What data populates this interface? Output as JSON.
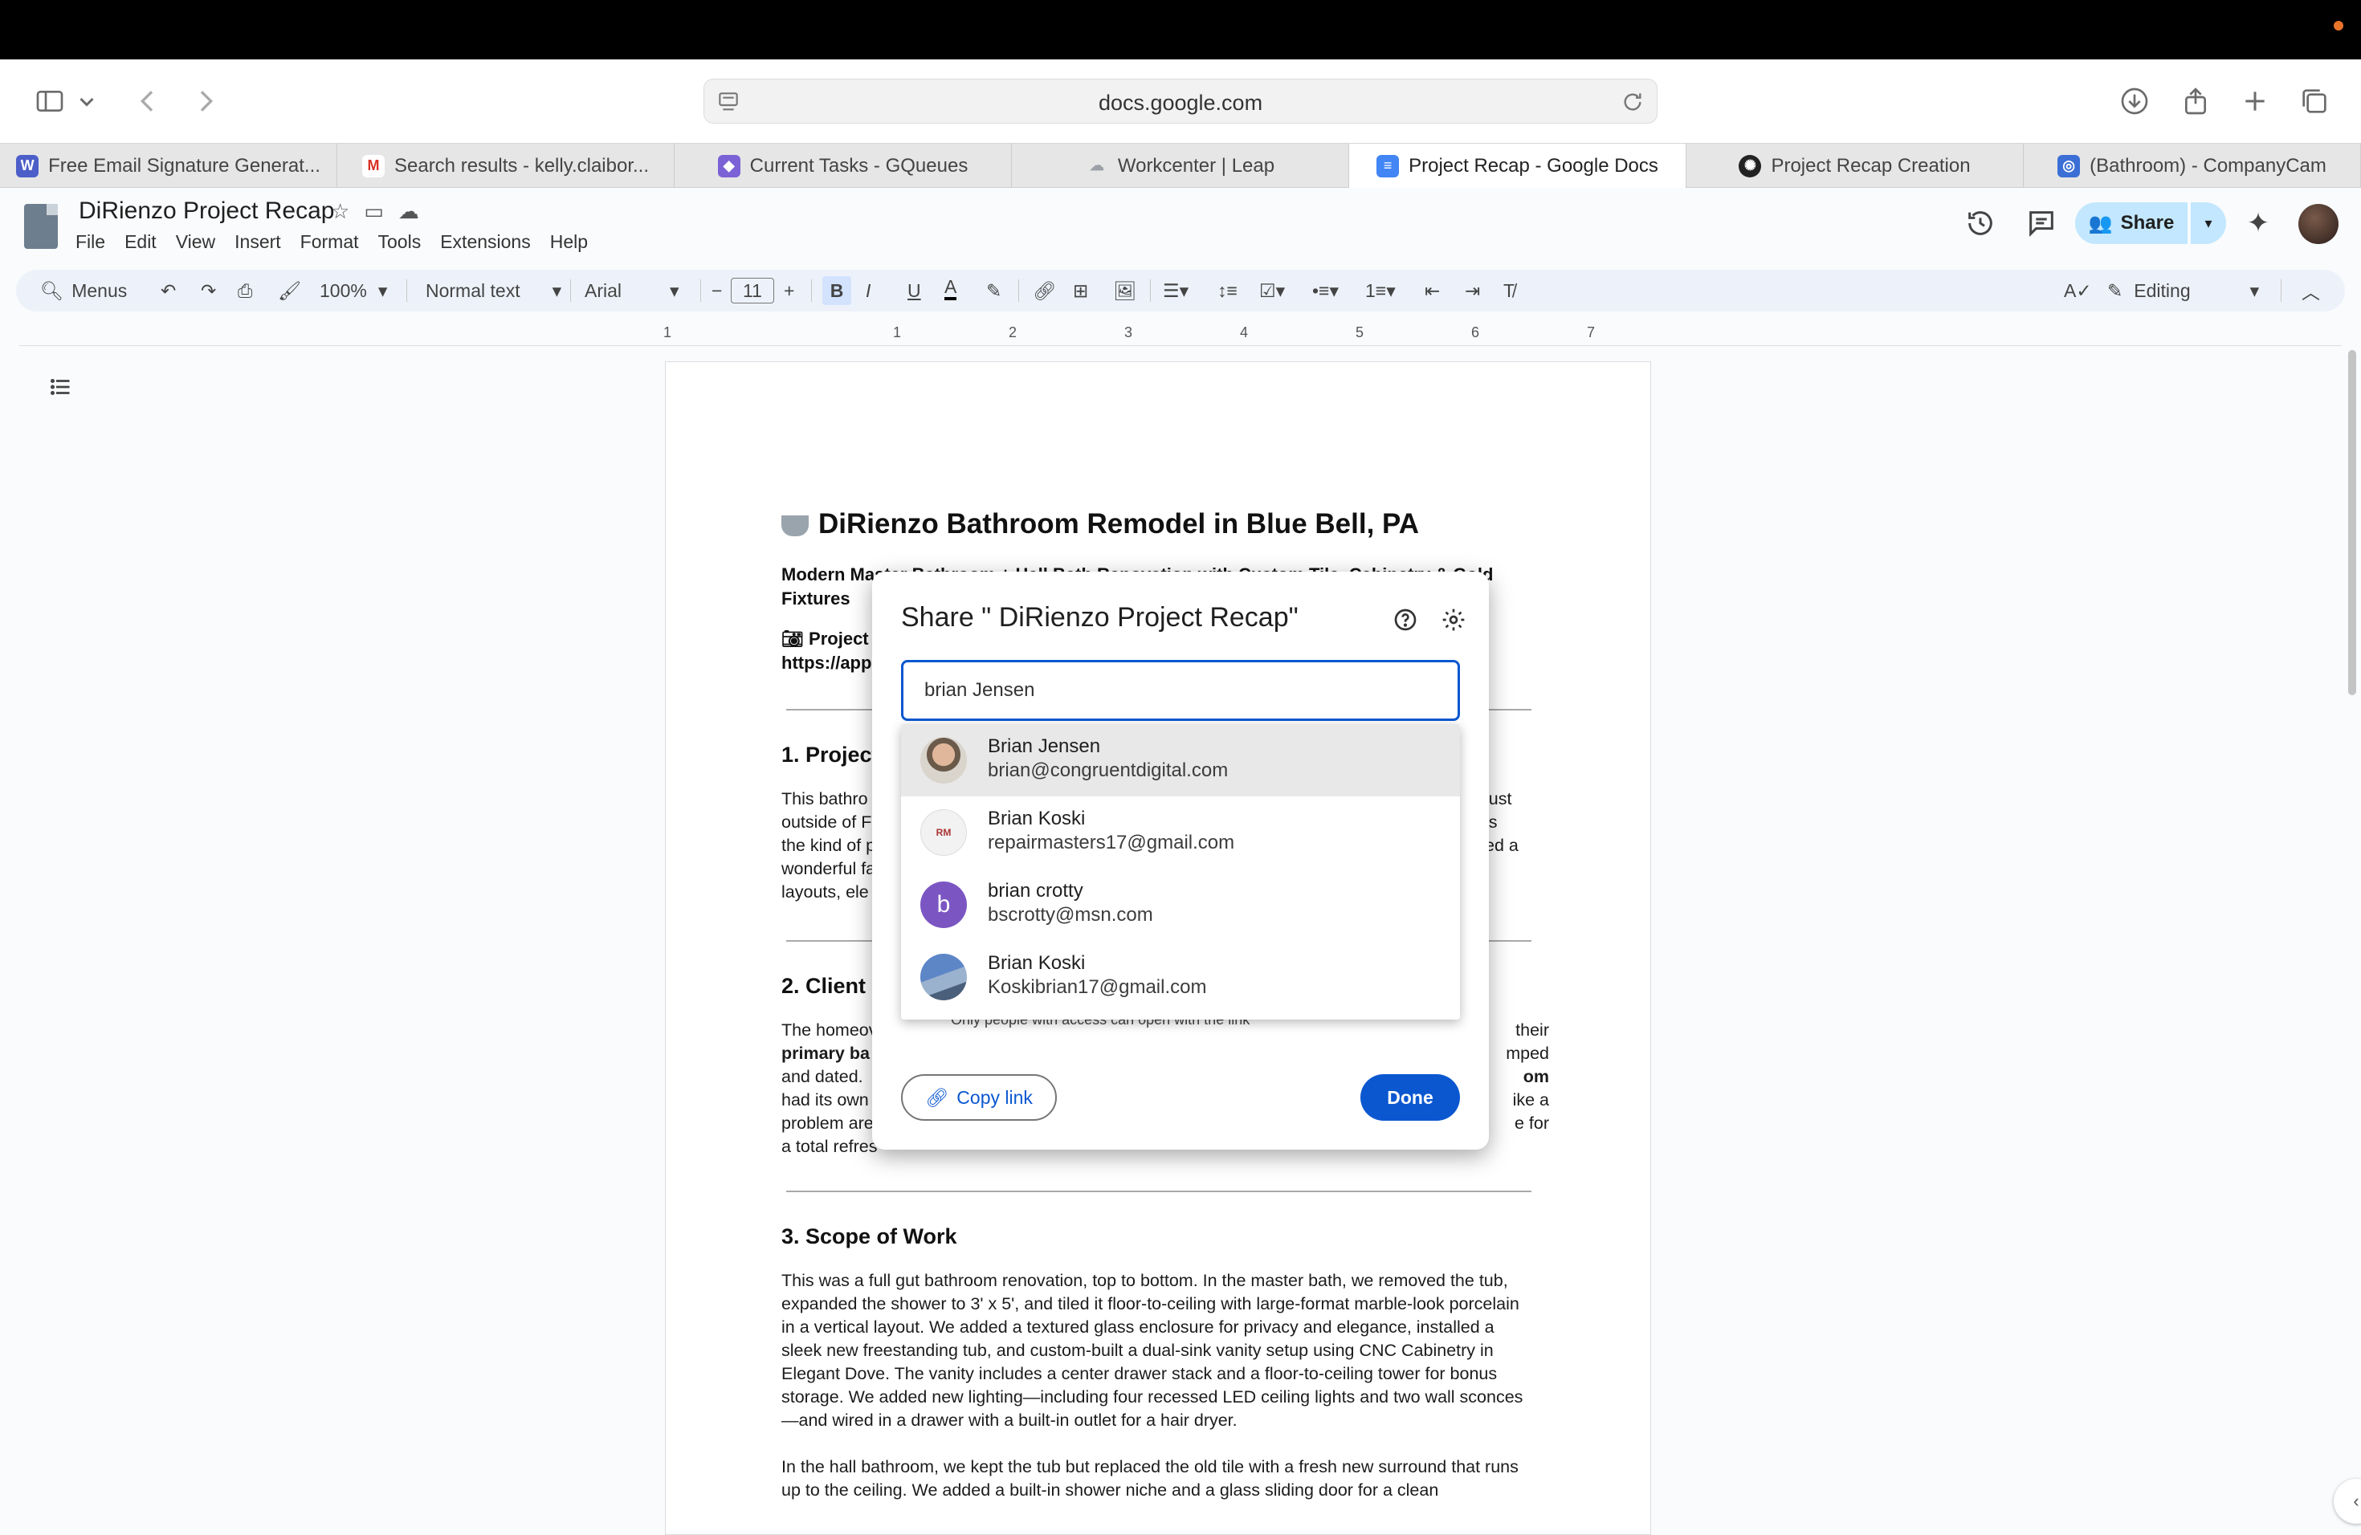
{
  "browser": {
    "url": "docs.google.com",
    "tabs": [
      {
        "label": "Free Email Signature Generat...",
        "icon": "wisestamp-icon",
        "color": "#4c5ec8",
        "glyph": "W"
      },
      {
        "label": "Search results - kelly.claibor...",
        "icon": "gmail-icon",
        "color": "#d93025",
        "glyph": "M"
      },
      {
        "label": "Current Tasks - GQueues",
        "icon": "gqueues-icon",
        "color": "#7b61d6",
        "glyph": "◆"
      },
      {
        "label": "Workcenter | Leap",
        "icon": "leap-icon",
        "color": "#9aa0a6",
        "glyph": "☁"
      },
      {
        "label": "Project Recap - Google Docs",
        "icon": "google-docs-icon",
        "color": "#4285f4",
        "glyph": "≡"
      },
      {
        "label": "Project Recap Creation",
        "icon": "openai-icon",
        "color": "#222222",
        "glyph": "✺"
      },
      {
        "label": "(Bathroom) - CompanyCam",
        "icon": "companycam-icon",
        "color": "#3b6fd6",
        "glyph": "◎"
      }
    ]
  },
  "doc": {
    "title": "DiRienzo Project Recap",
    "menus": [
      "File",
      "Edit",
      "View",
      "Insert",
      "Format",
      "Tools",
      "Extensions",
      "Help"
    ],
    "share_label": "Share",
    "editing_label": "Editing",
    "toolbar": {
      "menus_search": "Menus",
      "zoom": "100%",
      "style": "Normal text",
      "font": "Arial",
      "font_size": "11"
    },
    "ruler_ticks": [
      "1",
      "1",
      "2",
      "3",
      "4",
      "5",
      "6",
      "7"
    ],
    "heading": "DiRienzo Bathroom Remodel in Blue Bell, PA",
    "subtitle": "Modern Master Bathroom + Hall Bath Renovation with Custom Tile, Cabinetry & Gold Fixtures",
    "project_link_label": "Project",
    "project_link_url": "https://app.",
    "sections": [
      {
        "title": "1. Project",
        "lines": [
          "This bathro",
          "outside of F",
          "the kind of p",
          "wonderful fa",
          "layouts, ele"
        ],
        "right": [
          "just",
          "is",
          "ed a"
        ]
      },
      {
        "title": "2. Client C",
        "lines": [
          "The homeov",
          "primary ba",
          "and dated.",
          "had its own",
          "problem are",
          "a total refres"
        ],
        "right": [
          "their",
          "mped",
          "om",
          "ike a",
          "e for"
        ]
      },
      {
        "title": "3. Scope of Work"
      }
    ],
    "scope_p1": "This was a full gut bathroom renovation, top to bottom. In the master bath, we removed the tub, expanded the shower to 3' x 5', and tiled it floor-to-ceiling with large-format marble-look porcelain in a vertical layout. We added a textured glass enclosure for privacy and elegance, installed a sleek new freestanding tub, and custom-built a dual-sink vanity setup using CNC Cabinetry in Elegant Dove. The vanity includes a center drawer stack and a floor-to-ceiling tower for bonus storage. We added new lighting—including four recessed LED ceiling lights and two wall sconces—and wired in a drawer with a built-in outlet for a hair dryer.",
    "scope_p2": "In the hall bathroom, we kept the tub but replaced the old tile with a fresh new surround that runs up to the ceiling. We added a built-in shower niche and a glass sliding door for a clean"
  },
  "dialog": {
    "title": "Share \" DiRienzo Project Recap\"",
    "input_value": "brian Jensen",
    "access_note": "Only people with access can open with the link",
    "copy_link": "Copy link",
    "done": "Done",
    "suggestions": [
      {
        "name": "Brian Jensen",
        "email": "brian@congruentdigital.com",
        "avatar": "photo",
        "highlight": true
      },
      {
        "name": "Brian Koski",
        "email": "repairmasters17@gmail.com",
        "avatar": "logo",
        "highlight": false
      },
      {
        "name": "brian crotty",
        "email": "bscrotty@msn.com",
        "avatar": "letter",
        "letter": "b",
        "highlight": false
      },
      {
        "name": "Brian Koski",
        "email": "Koskibrian17@gmail.com",
        "avatar": "photo2",
        "highlight": false
      }
    ]
  }
}
